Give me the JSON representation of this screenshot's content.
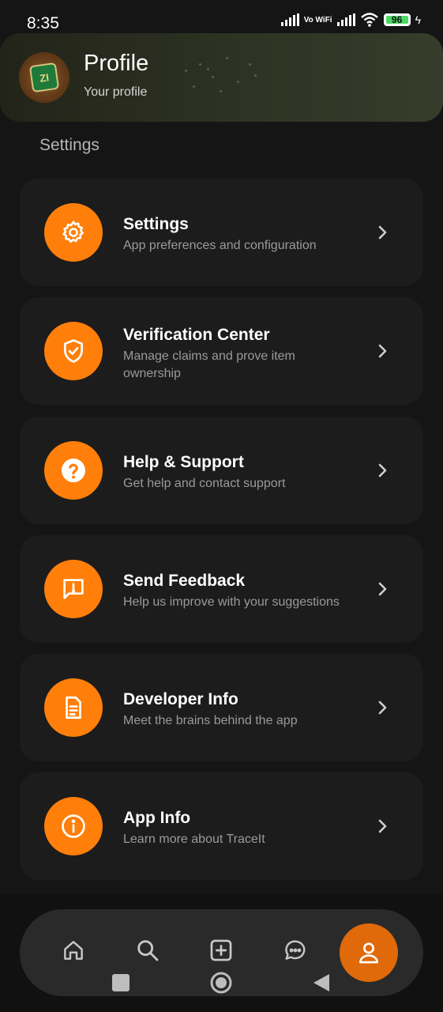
{
  "status_bar": {
    "time": "8:35",
    "network": "Vo WiFi",
    "battery": "96"
  },
  "header": {
    "title": "Profile",
    "subtitle": "Your profile",
    "avatar_text": "ZI"
  },
  "section_label": "Settings",
  "menu": [
    {
      "title": "Settings",
      "description": "App preferences and configuration",
      "icon": "gear-icon"
    },
    {
      "title": "Verification Center",
      "description": "Manage claims and prove item ownership",
      "icon": "shield-check-icon"
    },
    {
      "title": "Help & Support",
      "description": "Get help and contact support",
      "icon": "help-icon"
    },
    {
      "title": "Send Feedback",
      "description": "Help us improve with your suggestions",
      "icon": "feedback-icon"
    },
    {
      "title": "Developer Info",
      "description": "Meet the brains behind the app",
      "icon": "document-icon"
    },
    {
      "title": "App Info",
      "description": "Learn more about TraceIt",
      "icon": "info-icon"
    }
  ],
  "bottom_nav": [
    {
      "name": "home",
      "icon": "home-icon"
    },
    {
      "name": "search",
      "icon": "search-icon"
    },
    {
      "name": "add",
      "icon": "add-icon"
    },
    {
      "name": "chat",
      "icon": "chat-icon"
    },
    {
      "name": "profile",
      "icon": "profile-icon",
      "active": true
    }
  ],
  "colors": {
    "accent": "#ff7f0a",
    "background": "#151515",
    "card": "#1c1c1c"
  }
}
